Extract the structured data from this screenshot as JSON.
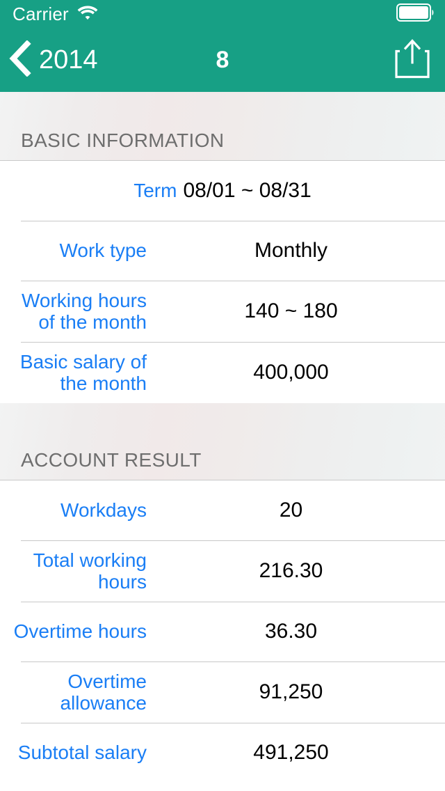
{
  "status_bar": {
    "carrier": "Carrier",
    "wifi_icon": "wifi-icon",
    "battery_icon": "battery-full-icon"
  },
  "nav_bar": {
    "back_label": "2014",
    "back_icon": "chevron-left-icon",
    "title": "8",
    "share_icon": "share-up-icon",
    "background_color": "#17a085"
  },
  "theme": {
    "accent_green": "#17a085",
    "label_blue": "#1a7ef5",
    "value_black": "#000000",
    "section_header_text": "#6e6e6e",
    "separator": "#c8c8c8"
  },
  "sections": [
    {
      "title": "BASIC INFORMATION",
      "rows": [
        {
          "style": "center-pair",
          "label": "Term",
          "value": "08/01 ~ 08/31"
        },
        {
          "style": "two-col",
          "label": "Work type",
          "value": "Monthly"
        },
        {
          "style": "two-col",
          "label": "Working hours\nof the month",
          "label_line1": "Working hours",
          "label_line2": "of the month",
          "value": "140 ~ 180"
        },
        {
          "style": "two-col",
          "label": "Basic salary of\nthe month",
          "label_line1": "Basic salary of",
          "label_line2": "the month",
          "value": "400,000"
        }
      ]
    },
    {
      "title": "ACCOUNT RESULT",
      "rows": [
        {
          "style": "two-col",
          "label": "Workdays",
          "value": "20"
        },
        {
          "style": "two-col",
          "label": "Total working\nhours",
          "label_line1": "Total working",
          "label_line2": "hours",
          "value": "216.30"
        },
        {
          "style": "two-col",
          "label": "Overtime hours",
          "value": "36.30"
        },
        {
          "style": "two-col",
          "label": "Overtime\nallowance",
          "label_line1": "Overtime",
          "label_line2": "allowance",
          "value": "91,250"
        },
        {
          "style": "two-col",
          "label": "Subtotal salary",
          "value": "491,250"
        }
      ]
    }
  ]
}
